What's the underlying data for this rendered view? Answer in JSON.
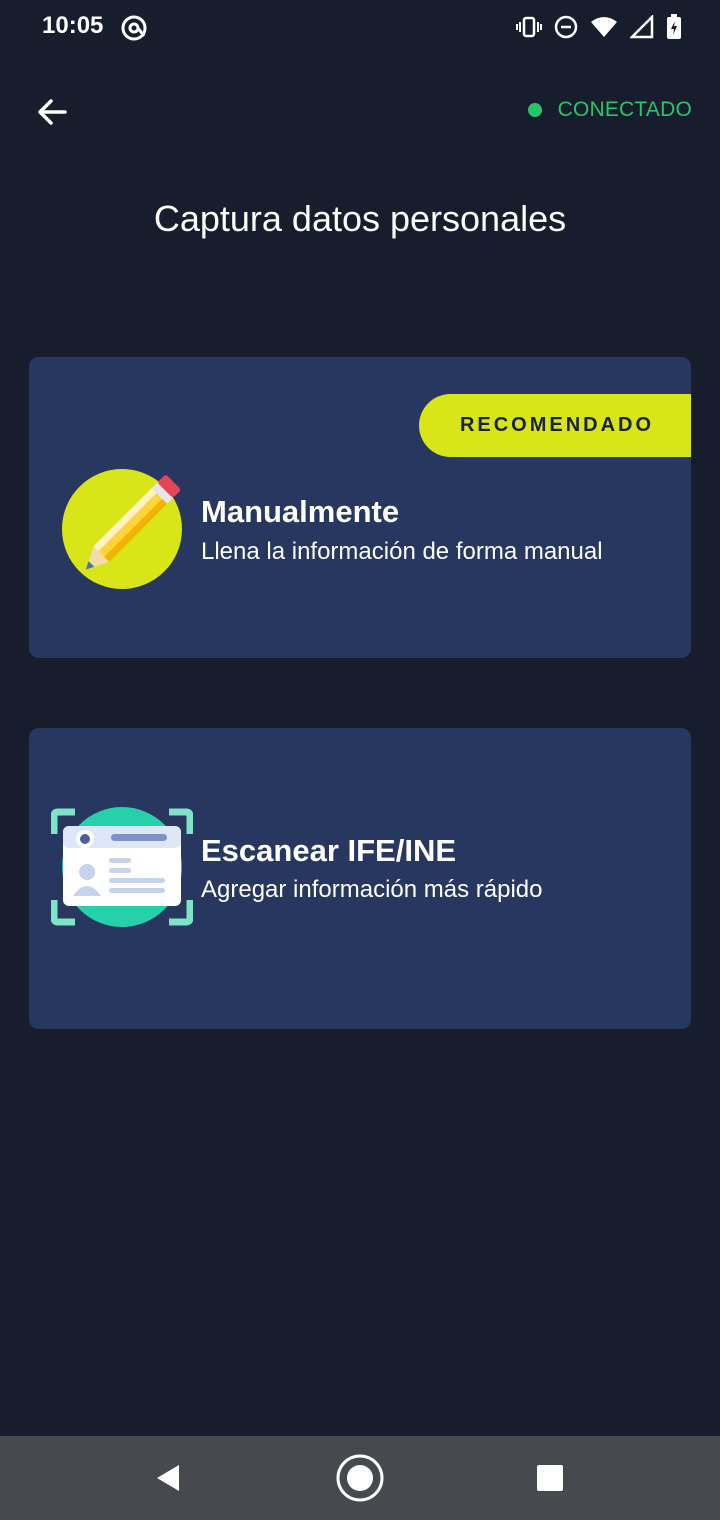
{
  "status_bar": {
    "time": "10:05",
    "icons": [
      "at-sign-icon",
      "vibrate-icon",
      "do-not-disturb-icon",
      "wifi-icon",
      "cell-signal-icon",
      "battery-charging-icon"
    ]
  },
  "header": {
    "back_icon": "arrow-left-icon",
    "connection_status": "CONECTADO",
    "connection_color": "#27c46b"
  },
  "page": {
    "title": "Captura datos personales"
  },
  "options": [
    {
      "badge": "RECOMENDADO",
      "title": "Manualmente",
      "subtitle": "Llena la información de forma manual",
      "icon": "pencil-icon"
    },
    {
      "title": "Escanear IFE/INE",
      "subtitle": "Agregar información más rápido",
      "icon": "id-card-scan-icon"
    }
  ],
  "nav_bar": {
    "icons": [
      "nav-back-icon",
      "nav-home-icon",
      "nav-recents-icon"
    ]
  },
  "colors": {
    "background": "#181d2e",
    "card": "#273760",
    "accent": "#d8e619",
    "connected": "#27c46b"
  }
}
